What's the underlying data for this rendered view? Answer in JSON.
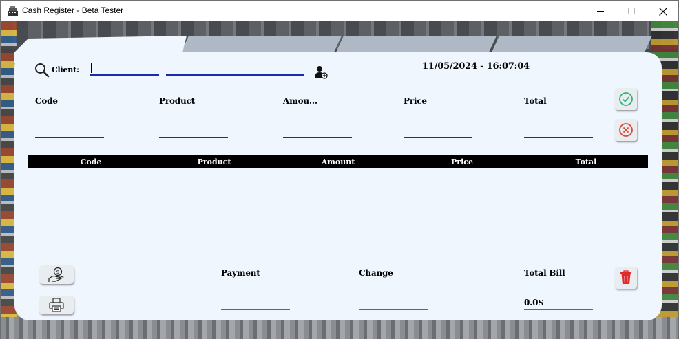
{
  "window": {
    "title": "Cash Register - Beta Tester",
    "minimize_label": "—",
    "maximize_label": "☐",
    "close_label": "✕"
  },
  "tabs": [
    {
      "label": ""
    },
    {
      "label": ""
    },
    {
      "label": ""
    }
  ],
  "client": {
    "label": "Client:",
    "code_value": "",
    "name_value": ""
  },
  "datetime": "11/05/2024 - 16:07:04",
  "entry": {
    "code_label": "Code",
    "product_label": "Product",
    "amount_label": "Amou...",
    "price_label": "Price",
    "total_label": "Total",
    "code_value": "",
    "product_value": "",
    "amount_value": "",
    "price_value": "",
    "total_value": ""
  },
  "table": {
    "columns": [
      "Code",
      "Product",
      "Amount",
      "Price",
      "Total"
    ],
    "rows": []
  },
  "footer": {
    "payment_label": "Payment",
    "change_label": "Change",
    "total_bill_label": "Total Bill",
    "payment_value": "",
    "change_value": "",
    "total_bill_value": "0.0$"
  },
  "colors": {
    "panel": "#eff6fe",
    "tab": "#aeb9c5",
    "underline": "#1b2aa8",
    "underline_footer": "#3c7f57",
    "confirm": "#2fb37a",
    "cancel": "#e0453a",
    "delete": "#e02a2a"
  }
}
